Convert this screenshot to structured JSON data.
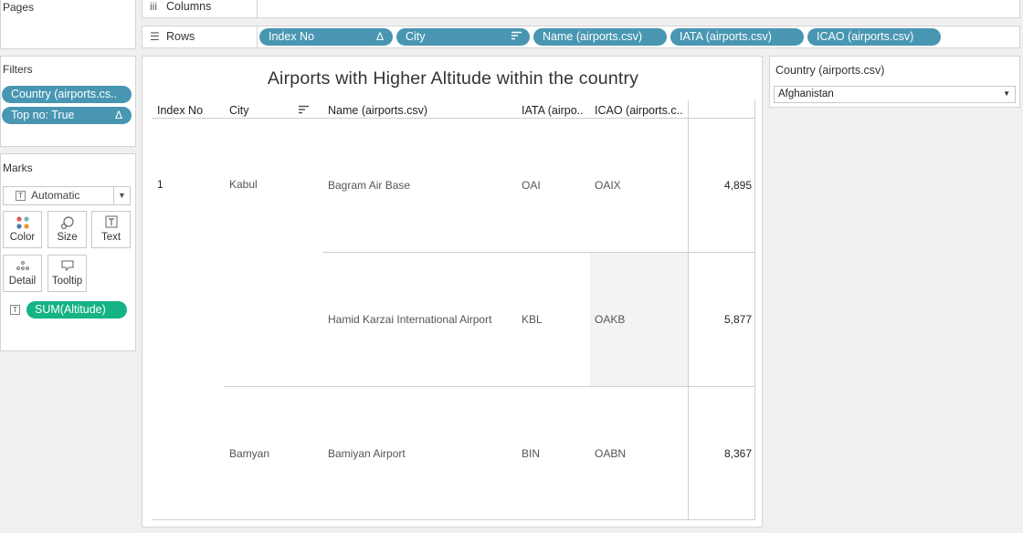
{
  "pages": {
    "title": "Pages"
  },
  "filters": {
    "title": "Filters",
    "pills": [
      {
        "label": "Country (airports.cs..",
        "icon": ""
      },
      {
        "label": "Top no: True",
        "icon": "Δ"
      }
    ]
  },
  "marks": {
    "title": "Marks",
    "type": "Automatic",
    "type_icon": "T",
    "buttons": [
      {
        "label": "Color",
        "icon": "color-dots-icon"
      },
      {
        "label": "Size",
        "icon": "size-bubbles-icon"
      },
      {
        "label": "Text",
        "icon": "text-icon"
      },
      {
        "label": "Detail",
        "icon": "detail-dots-icon"
      },
      {
        "label": "Tooltip",
        "icon": "tooltip-icon"
      }
    ],
    "field": {
      "label": "SUM(Altitude)",
      "icon": "T"
    }
  },
  "shelves": {
    "columns": {
      "label": "Columns",
      "icon": "iii"
    },
    "rows": {
      "label": "Rows",
      "icon": "☰",
      "pills": [
        {
          "label": "Index No",
          "icon": "Δ"
        },
        {
          "label": "City",
          "icon": "sort-icon"
        },
        {
          "label": "Name (airports.csv)",
          "icon": ""
        },
        {
          "label": "IATA (airports.csv)",
          "icon": ""
        },
        {
          "label": "ICAO (airports.csv)",
          "icon": ""
        }
      ]
    }
  },
  "view": {
    "title": "Airports with Higher Altitude within the country",
    "headers": [
      "Index No",
      "City",
      "Name (airports.csv)",
      "IATA (airpo..",
      "ICAO (airports.c.."
    ],
    "rows": [
      {
        "index": "1",
        "city": "Kabul",
        "name": "Bagram Air Base",
        "iata": "OAI",
        "icao": "OAIX",
        "altitude": "4,895"
      },
      {
        "index": "",
        "city": "",
        "name": "Hamid Karzai International Airport",
        "iata": "KBL",
        "icao": "OAKB",
        "altitude": "5,877"
      },
      {
        "index": "",
        "city": "Bamyan",
        "name": "Bamiyan Airport",
        "iata": "BIN",
        "icao": "OABN",
        "altitude": "8,367"
      }
    ]
  },
  "country_filter": {
    "title": "Country (airports.csv)",
    "value": "Afghanistan"
  },
  "colors": {
    "pill_blue": "#4996b2",
    "pill_green": "#13b385"
  }
}
